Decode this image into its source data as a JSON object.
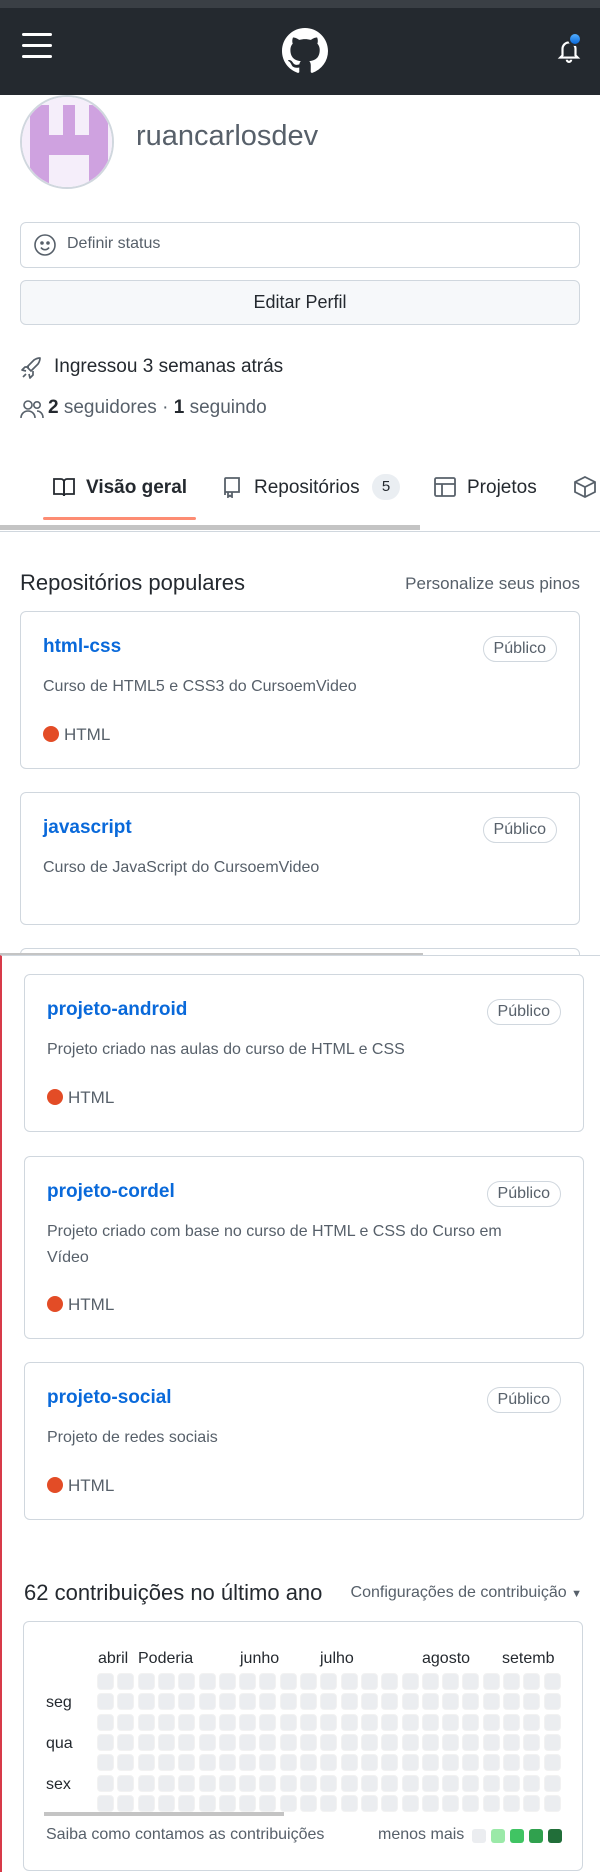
{
  "header": {
    "menu_icon": "hamburger-icon",
    "logo_icon": "github-logo-icon",
    "notification_icon": "bell-icon"
  },
  "profile": {
    "username": "ruancarlosdev",
    "status_placeholder": "Definir status",
    "edit_button": "Editar Perfil",
    "joined": "Ingressou 3 semanas atrás",
    "followers_count": "2",
    "followers_label": "seguidores",
    "separator": "·",
    "following_count": "1",
    "following_label": "seguindo"
  },
  "tabs": [
    {
      "label": "Visão geral",
      "icon": "book-icon",
      "selected": true
    },
    {
      "label": "Repositórios",
      "icon": "repo-icon",
      "count": "5"
    },
    {
      "label": "Projetos",
      "icon": "table-icon"
    },
    {
      "label": "",
      "icon": "package-icon"
    }
  ],
  "popular": {
    "title": "Repositórios populares",
    "customize": "Personalize seus pinos",
    "repos": [
      {
        "name": "html-css",
        "visibility": "Público",
        "description": "Curso de HTML5 e CSS3 do CursoemVideo",
        "language": "HTML"
      },
      {
        "name": "javascript",
        "visibility": "Público",
        "description": "Curso de JavaScript do CursoemVideo",
        "language": ""
      },
      {
        "name": "projeto-android",
        "visibility": "Público",
        "description": "Projeto criado nas aulas do curso de HTML e CSS",
        "language": "HTML"
      },
      {
        "name": "projeto-cordel",
        "visibility": "Público",
        "description": "Projeto criado com base no curso de HTML e CSS do Curso em Vídeo",
        "language": "HTML"
      },
      {
        "name": "projeto-social",
        "visibility": "Público",
        "description": "Projeto de redes sociais",
        "language": "HTML"
      }
    ]
  },
  "contributions": {
    "title": "62 contribuições no último ano",
    "settings": "Configurações de contribuição",
    "months": [
      "abril",
      "Poderia",
      "junho",
      "julho",
      "agosto",
      "setemb"
    ],
    "days": [
      "seg",
      "qua",
      "sex"
    ],
    "learn_link": "Saiba como contamos as contribuições",
    "legend_less": "menos",
    "legend_more": "mais",
    "legend_colors": [
      "#ebedf0",
      "#9be9a8",
      "#40c463",
      "#30a14e",
      "#216e39"
    ]
  },
  "colors": {
    "accent": "#0969da",
    "lang_html": "#e34c26",
    "tab_underline": "#fd8c73",
    "header_bg": "#24292f"
  }
}
